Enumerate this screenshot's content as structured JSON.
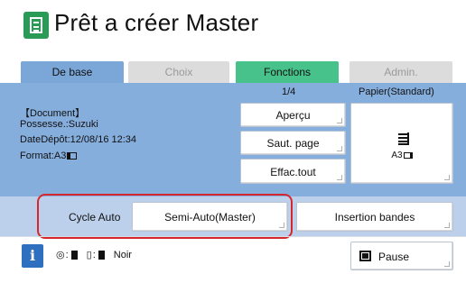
{
  "header": {
    "title": "Prêt a créer Master",
    "logo_icon": "master-document-icon"
  },
  "tabs": [
    {
      "label": "De base",
      "active": true,
      "color": "#7aa6d8"
    },
    {
      "label": "Choix",
      "active": false,
      "color": "#dcdcdc"
    },
    {
      "label": "Fonctions",
      "active": false,
      "color": "#47c28b"
    },
    {
      "label": "Admin.",
      "active": false,
      "color": "#dcdcdc"
    }
  ],
  "document": {
    "title": "【Document】",
    "owner": "Possesse.:Suzuki",
    "date": "DateDépôt:12/08/16 12:34",
    "format": "Format:A3"
  },
  "pager": "1/4",
  "actions": {
    "apercu": "Aperçu",
    "saut_page": "Saut. page",
    "effac_tout": "Effac.tout"
  },
  "paper": {
    "label": "Papier(Standard)",
    "size": "A3",
    "icon": "paper-stack-icon"
  },
  "cycle": {
    "label": "Cycle Auto",
    "mode": "Semi-Auto(Master)",
    "insertion": "Insertion bandes",
    "highlight_color": "#d7272e"
  },
  "status": {
    "info_icon": "i",
    "color": "Noir",
    "master_icon": "master-roll-icon",
    "ink_icon": "ink-cartridge-icon"
  },
  "pause": {
    "label": "Pause",
    "icon": "pause-tray-icon"
  },
  "colors": {
    "panel": "#86aedd",
    "cycle_bar": "#bcd0eb",
    "logo": "#2a9a57"
  }
}
